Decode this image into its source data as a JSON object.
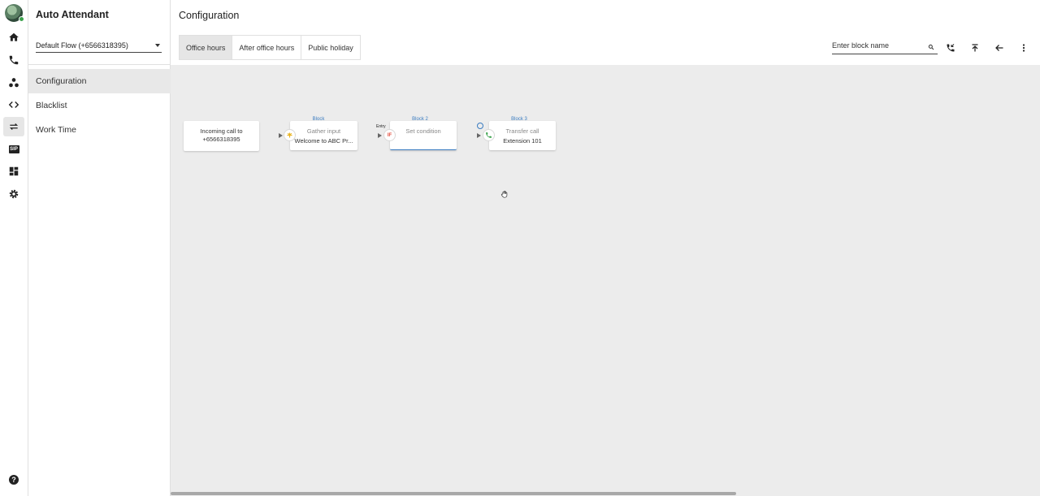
{
  "app": {
    "title": "Auto Attendant"
  },
  "sidebar": {
    "flow_select": "Default Flow (+6566318395)",
    "items": [
      {
        "label": "Configuration",
        "active": true
      },
      {
        "label": "Blacklist",
        "active": false
      },
      {
        "label": "Work Time",
        "active": false
      }
    ]
  },
  "rail": {
    "icons": [
      "home-icon",
      "phone-icon",
      "contacts-icon",
      "code-icon",
      "transfer-icon",
      "sip-icon",
      "dashboard-icon",
      "gear-icon",
      "help-icon"
    ],
    "sip_label": "SIP",
    "help_label": "?"
  },
  "main": {
    "title": "Configuration",
    "tabs": [
      {
        "label": "Office hours",
        "active": true
      },
      {
        "label": "After office hours",
        "active": false
      },
      {
        "label": "Public holiday",
        "active": false
      }
    ],
    "search": {
      "placeholder": "Enter block name"
    }
  },
  "flow": {
    "incoming": {
      "line1": "Incoming call to",
      "line2": "+6566318395"
    },
    "blocks": [
      {
        "label": "Block",
        "title": "Gather input",
        "detail": "Welcome to ABC Pr..."
      },
      {
        "label": "Block 2",
        "title": "Set condition",
        "detail": "",
        "tag": "Entry",
        "badge": "IF"
      },
      {
        "label": "Block 3",
        "title": "Transfer call",
        "detail": "Extension 101"
      }
    ]
  },
  "colors": {
    "accent": "#3a7cc0",
    "canvas": "#ececec",
    "if_badge": "#e24c3c",
    "gather_badge": "#e8b21a",
    "call_badge": "#3aa14b"
  }
}
